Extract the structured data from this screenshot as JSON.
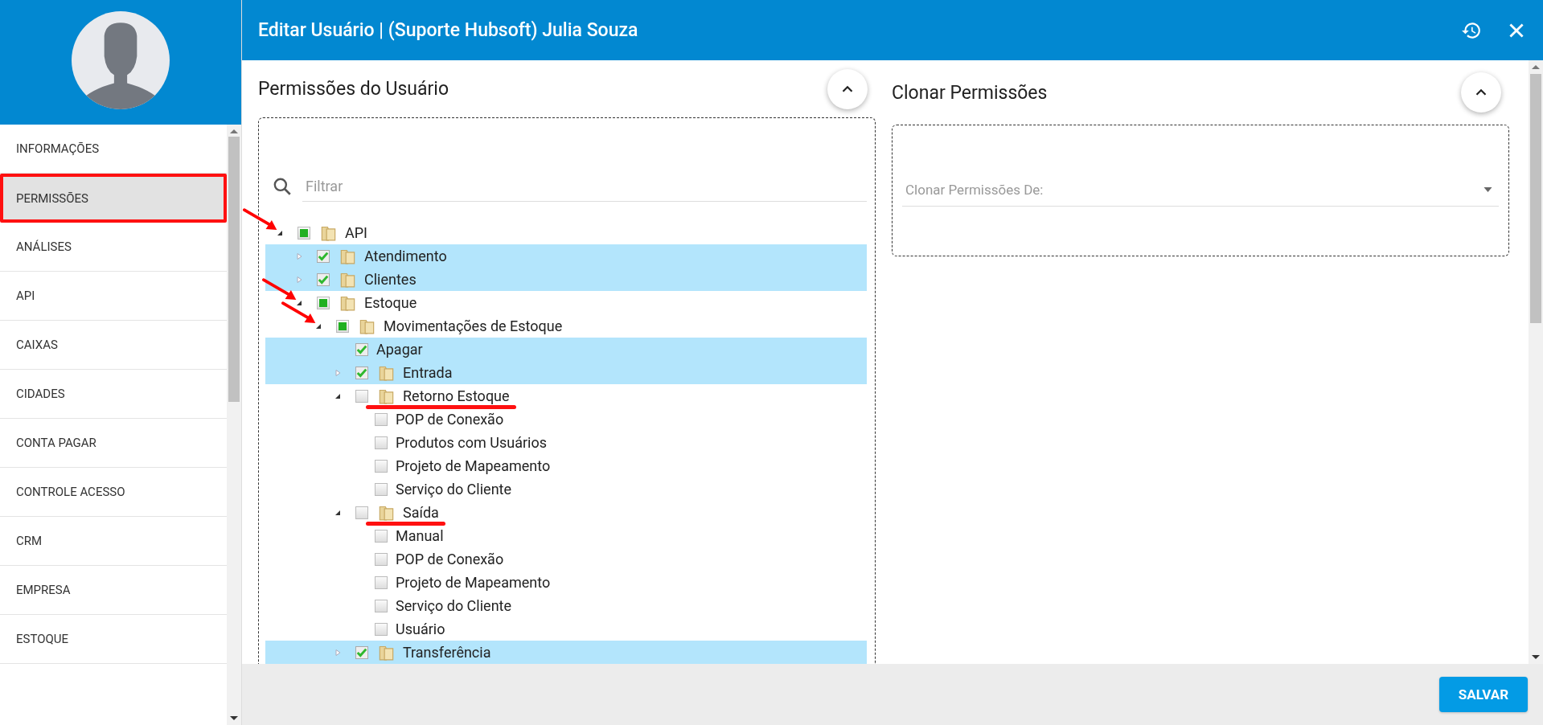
{
  "header": {
    "title": "Editar Usuário | (Suporte Hubsoft) Julia Souza"
  },
  "sidebar": {
    "items": [
      {
        "label": "INFORMAÇÕES",
        "selected": false,
        "highlighted": false
      },
      {
        "label": "PERMISSÕES",
        "selected": true,
        "highlighted": true
      },
      {
        "label": "ANÁLISES",
        "selected": false,
        "highlighted": false
      },
      {
        "label": "API",
        "selected": false,
        "highlighted": false
      },
      {
        "label": "CAIXAS",
        "selected": false,
        "highlighted": false
      },
      {
        "label": "CIDADES",
        "selected": false,
        "highlighted": false
      },
      {
        "label": "CONTA PAGAR",
        "selected": false,
        "highlighted": false
      },
      {
        "label": "CONTROLE ACESSO",
        "selected": false,
        "highlighted": false
      },
      {
        "label": "CRM",
        "selected": false,
        "highlighted": false
      },
      {
        "label": "EMPRESA",
        "selected": false,
        "highlighted": false
      },
      {
        "label": "ESTOQUE",
        "selected": false,
        "highlighted": false
      }
    ]
  },
  "permissions": {
    "title": "Permissões do Usuário",
    "filter": {
      "placeholder": "Filtrar"
    },
    "tree": [
      {
        "label": "API",
        "checked": false,
        "partial": true,
        "folder": true,
        "expanded": true,
        "selected": false,
        "arrow": true,
        "children": [
          {
            "label": "Atendimento",
            "checked": true,
            "folder": true,
            "expanded": false,
            "selected": true
          },
          {
            "label": "Clientes",
            "checked": true,
            "folder": true,
            "expanded": false,
            "selected": true
          },
          {
            "label": "Estoque",
            "checked": false,
            "partial": true,
            "folder": true,
            "expanded": true,
            "selected": false,
            "arrow": true,
            "children": [
              {
                "label": "Movimentações de Estoque",
                "checked": false,
                "partial": true,
                "folder": true,
                "expanded": true,
                "selected": false,
                "arrow": true,
                "children": [
                  {
                    "label": "Apagar",
                    "checked": true,
                    "selected": true
                  },
                  {
                    "label": "Entrada",
                    "checked": true,
                    "folder": true,
                    "expanded": false,
                    "selected": true
                  },
                  {
                    "label": "Retorno Estoque",
                    "checked": false,
                    "partial": false,
                    "folder": true,
                    "expanded": true,
                    "selected": false,
                    "underlined": true,
                    "children": [
                      {
                        "label": "POP de Conexão",
                        "checked": false,
                        "partial": false,
                        "selected": false
                      },
                      {
                        "label": "Produtos com Usuários",
                        "checked": false,
                        "partial": false,
                        "selected": false
                      },
                      {
                        "label": "Projeto de Mapeamento",
                        "checked": false,
                        "partial": false,
                        "selected": false
                      },
                      {
                        "label": "Serviço do Cliente",
                        "checked": false,
                        "partial": false,
                        "selected": false
                      }
                    ]
                  },
                  {
                    "label": "Saída",
                    "checked": false,
                    "partial": false,
                    "folder": true,
                    "expanded": true,
                    "selected": false,
                    "underlined": true,
                    "children": [
                      {
                        "label": "Manual",
                        "checked": false,
                        "partial": false,
                        "selected": false
                      },
                      {
                        "label": "POP de Conexão",
                        "checked": false,
                        "partial": false,
                        "selected": false
                      },
                      {
                        "label": "Projeto de Mapeamento",
                        "checked": false,
                        "partial": false,
                        "selected": false
                      },
                      {
                        "label": "Serviço do Cliente",
                        "checked": false,
                        "partial": false,
                        "selected": false
                      },
                      {
                        "label": "Usuário",
                        "checked": false,
                        "partial": false,
                        "selected": false
                      }
                    ]
                  },
                  {
                    "label": "Transferência",
                    "checked": true,
                    "folder": true,
                    "expanded": false,
                    "selected": true
                  }
                ]
              }
            ]
          }
        ]
      }
    ]
  },
  "clone": {
    "title": "Clonar Permissões",
    "select": {
      "placeholder": "Clonar Permissões De:"
    }
  },
  "footer": {
    "save_button": "SALVAR"
  }
}
